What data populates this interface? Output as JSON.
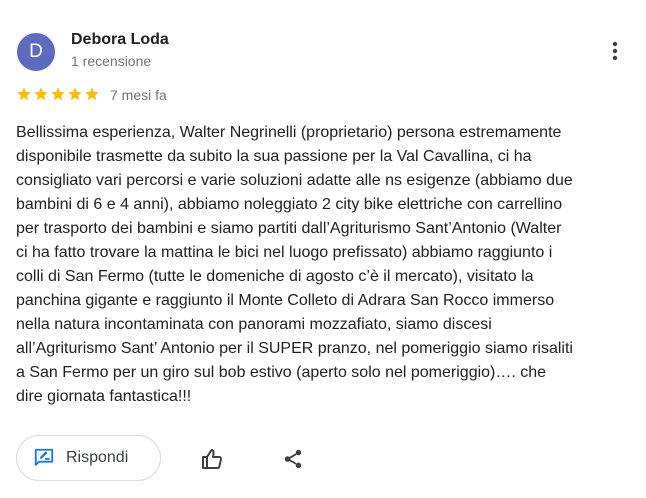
{
  "review": {
    "author": {
      "initial": "D",
      "name": "Debora Loda",
      "subtitle": "1 recensione",
      "avatar_color": "#5c6bc0"
    },
    "rating": 5,
    "rating_max": 5,
    "star_color": "#fbbc04",
    "date": "7 mesi fa",
    "text": "Bellissima esperienza, Walter Negrinelli (proprietario) persona estremamente\ndisponibile trasmette da subito la sua passione per la Val Cavallina, ci ha\nconsigliato vari percorsi e varie soluzioni adatte alle ns esigenze (abbiamo due\nbambini di 6 e 4 anni), abbiamo noleggiato 2 city bike elettriche con carrellino\nper trasporto dei bambini e siamo partiti dall’Agriturismo Sant’Antonio (Walter\nci ha fatto trovare la mattina le bici nel luogo prefissato) abbiamo raggiunto i\ncolli di San Fermo (tutte le domeniche di agosto c’è il mercato), visitato la\npanchina gigante e raggiunto il Monte Colleto di Adrara San Rocco immerso\nnella natura incontaminata con panorami mozzafiato, siamo discesi\nall’Agriturismo Sant’ Antonio per il SUPER pranzo, nel pomeriggio siamo risaliti\na San Fermo per un giro sul bob estivo (aperto solo nel pomeriggio)…. che\ndire giornata fantastica!!!"
  },
  "actions": {
    "reply_label": "Rispondi",
    "reply_icon": "edit-reply-icon",
    "like_icon": "thumbs-up-icon",
    "share_icon": "share-icon",
    "more_icon": "more-vert-icon",
    "accent_color": "#1a73e8"
  }
}
